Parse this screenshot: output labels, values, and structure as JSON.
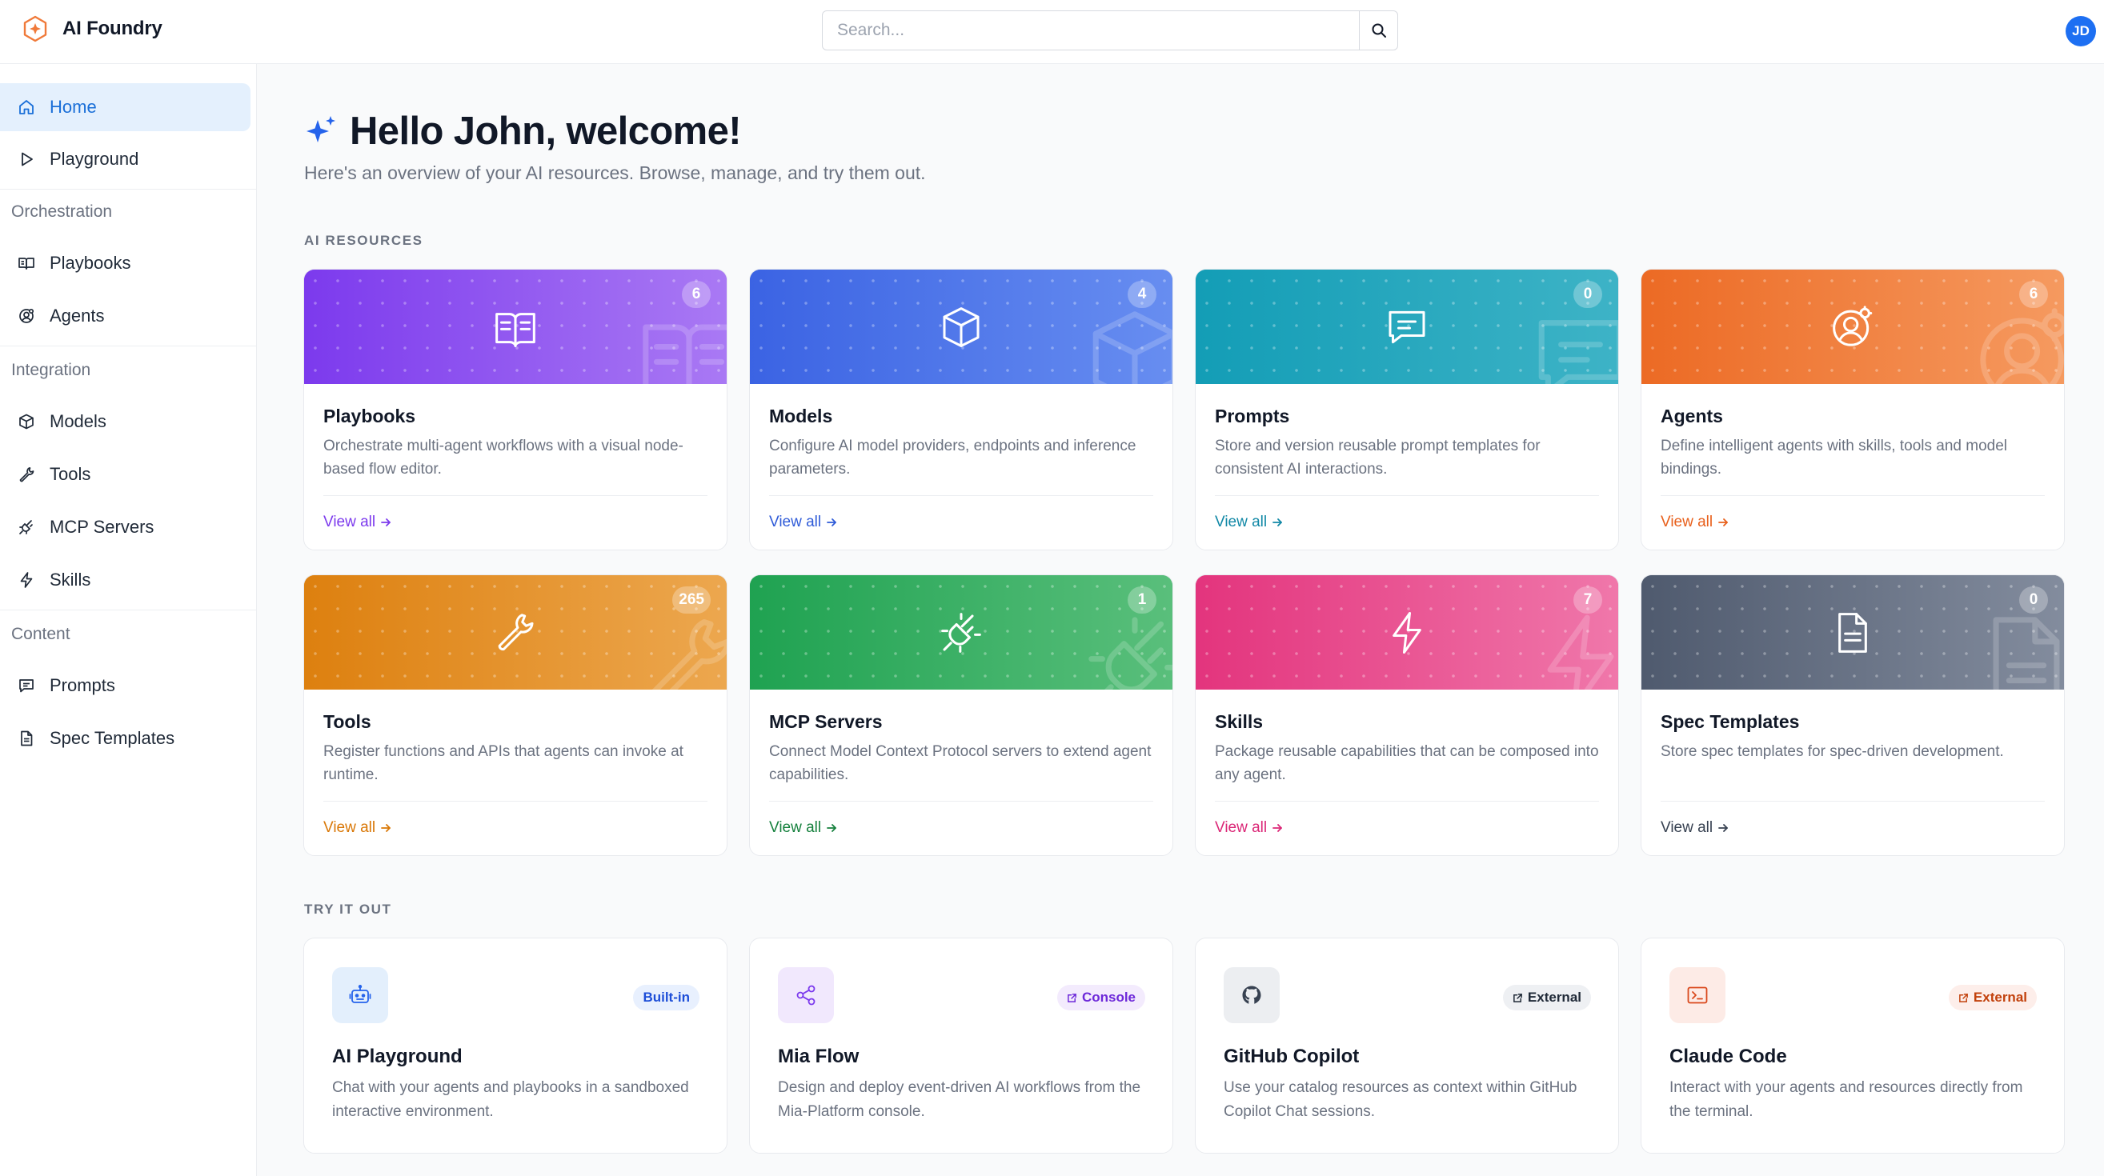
{
  "app": {
    "name": "AI Foundry"
  },
  "header": {
    "search_placeholder": "Search...",
    "avatar_initials": "JD"
  },
  "sidebar": {
    "items": [
      {
        "label": "Home",
        "icon": "home-icon",
        "active": true
      },
      {
        "label": "Playground",
        "icon": "play-icon"
      }
    ],
    "sections": [
      {
        "title": "Orchestration",
        "items": [
          {
            "label": "Playbooks",
            "icon": "book-icon"
          },
          {
            "label": "Agents",
            "icon": "agent-icon"
          }
        ]
      },
      {
        "title": "Integration",
        "items": [
          {
            "label": "Models",
            "icon": "cube-icon"
          },
          {
            "label": "Tools",
            "icon": "wrench-icon"
          },
          {
            "label": "MCP Servers",
            "icon": "plug-icon"
          },
          {
            "label": "Skills",
            "icon": "bolt-icon"
          }
        ]
      },
      {
        "title": "Content",
        "items": [
          {
            "label": "Prompts",
            "icon": "chat-icon"
          },
          {
            "label": "Spec Templates",
            "icon": "document-icon"
          }
        ]
      }
    ]
  },
  "main": {
    "greeting": "Hello John, welcome!",
    "subtitle": "Here's an overview of your AI resources. Browse, manage, and try them out.",
    "resources_label": "AI RESOURCES",
    "try_label": "TRY IT OUT",
    "view_all_label": "View all",
    "resources": [
      {
        "title": "Playbooks",
        "count": "6",
        "desc": "Orchestrate multi-agent workflows with a visual node-based flow editor.",
        "icon": "book-icon",
        "color_from": "#7c3aed",
        "color_to": "#b184f5",
        "link_color": "#7c3aed"
      },
      {
        "title": "Models",
        "count": "4",
        "desc": "Configure AI model providers, endpoints and inference parameters.",
        "icon": "cube-icon",
        "color_from": "#3b63e3",
        "color_to": "#6f95f3",
        "link_color": "#2f5bd8"
      },
      {
        "title": "Prompts",
        "count": "0",
        "desc": "Store and version reusable prompt templates for consistent AI interactions.",
        "icon": "chat-icon",
        "color_from": "#139db6",
        "color_to": "#45b7c9",
        "link_color": "#1188a6"
      },
      {
        "title": "Agents",
        "count": "6",
        "desc": "Define intelligent agents with skills, tools and model bindings.",
        "icon": "agent-icon",
        "color_from": "#ec6a24",
        "color_to": "#f7a26a",
        "link_color": "#e8601c"
      },
      {
        "title": "Tools",
        "count": "265",
        "desc": "Register functions and APIs that agents can invoke at runtime.",
        "icon": "wrench-icon",
        "color_from": "#dd800f",
        "color_to": "#efae5a",
        "link_color": "#d97706"
      },
      {
        "title": "MCP Servers",
        "count": "1",
        "desc": "Connect Model Context Protocol servers to extend agent capabilities.",
        "icon": "plug-icon",
        "color_from": "#1fa251",
        "color_to": "#64c483",
        "link_color": "#15803d"
      },
      {
        "title": "Skills",
        "count": "7",
        "desc": "Package reusable capabilities that can be composed into any agent.",
        "icon": "bolt-icon",
        "color_from": "#e3347d",
        "color_to": "#f283b2",
        "link_color": "#db2777"
      },
      {
        "title": "Spec Templates",
        "count": "0",
        "desc": "Store spec templates for spec-driven development.",
        "icon": "document-icon",
        "color_from": "#4f5a6e",
        "color_to": "#8c95a6",
        "link_color": "#374151"
      }
    ],
    "tryouts": [
      {
        "title": "AI Playground",
        "badge": "Built-in",
        "desc": "Chat with your agents and playbooks in a sandboxed interactive environment.",
        "icon": "robot-icon",
        "icon_bg": "#e3effc",
        "icon_color": "#2563eb",
        "badge_bg": "#e8f0fe",
        "badge_color": "#1d4ed8",
        "badge_icon": false
      },
      {
        "title": "Mia Flow",
        "badge": "Console",
        "desc": "Design and deploy event-driven AI workflows from the Mia-Platform console.",
        "icon": "share-icon",
        "icon_bg": "#f1e8fd",
        "icon_color": "#7c3aed",
        "badge_bg": "#f3ebfd",
        "badge_color": "#6d28d9",
        "badge_icon": true
      },
      {
        "title": "GitHub Copilot",
        "badge": "External",
        "desc": "Use your catalog resources as context within GitHub Copilot Chat sessions.",
        "icon": "github-icon",
        "icon_bg": "#eceef1",
        "icon_color": "#374151",
        "badge_bg": "#eef0f3",
        "badge_color": "#1f2937",
        "badge_icon": true
      },
      {
        "title": "Claude Code",
        "badge": "External",
        "desc": "Interact with your agents and resources directly from the terminal.",
        "icon": "terminal-icon",
        "icon_bg": "#fdebe6",
        "icon_color": "#d9481c",
        "badge_bg": "#fdeeea",
        "badge_color": "#c2410c",
        "badge_icon": true
      }
    ]
  }
}
